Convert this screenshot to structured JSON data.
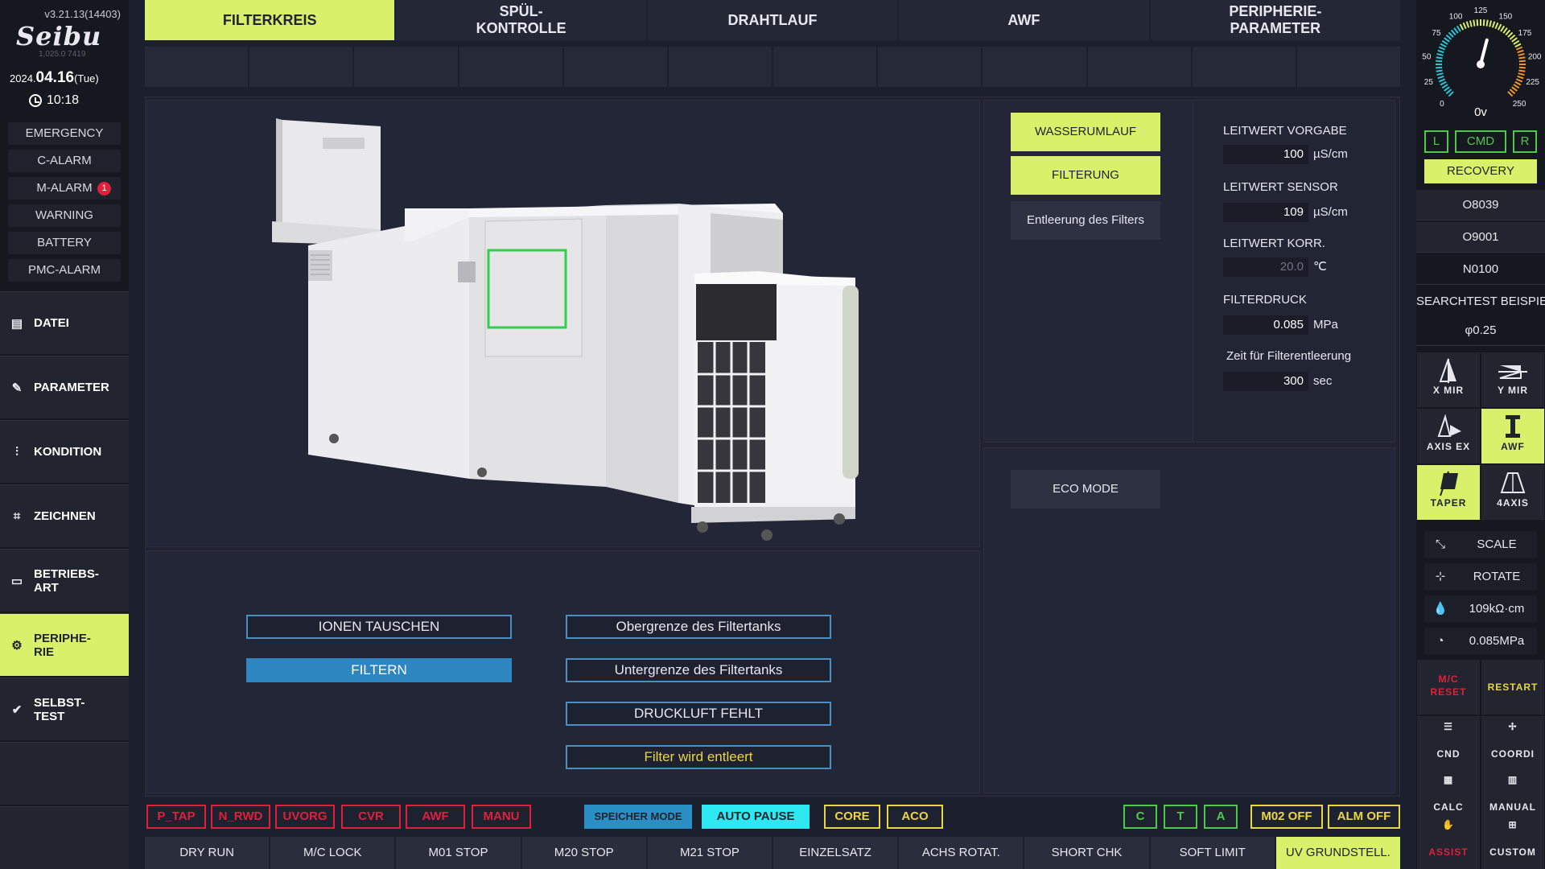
{
  "header": {
    "version": "v3.21.13(14403)",
    "brand": "Seibu",
    "brand_sub": "1,025.0    7419",
    "date_year": "2024.",
    "date_day": "04.16",
    "date_weekday": "(Tue)",
    "time": "10:18"
  },
  "alarms": [
    {
      "label": "EMERGENCY"
    },
    {
      "label": "C-ALARM"
    },
    {
      "label": "M-ALARM",
      "badge": "1"
    },
    {
      "label": "WARNING"
    },
    {
      "label": "BATTERY"
    },
    {
      "label": "PMC-ALARM"
    }
  ],
  "nav": [
    {
      "label": "DATEI",
      "icon": "file-icon"
    },
    {
      "label": "PARAMETER",
      "icon": "wrench-icon"
    },
    {
      "label": "KONDITION",
      "icon": "sliders-icon"
    },
    {
      "label": "ZEICHNEN",
      "icon": "draw-icon"
    },
    {
      "label_line1": "BETRIEBS-",
      "label_line2": "ART",
      "icon": "window-icon"
    },
    {
      "label_line1": "PERIPHE-",
      "label_line2": "RIE",
      "icon": "gear-icon",
      "active": true
    },
    {
      "label_line1": "SELBST-",
      "label_line2": "TEST",
      "icon": "check-icon"
    }
  ],
  "tabs": [
    {
      "label": "FILTERKREIS",
      "active": true
    },
    {
      "label_line1": "SPÜL-",
      "label_line2": "KONTROLLE"
    },
    {
      "label": "DRAHTLAUF"
    },
    {
      "label": "AWF"
    },
    {
      "label_line1": "PERIPHERIE-",
      "label_line2": "PARAMETER"
    }
  ],
  "controls": {
    "wasserumlauf": "WASSERUMLAUF",
    "filterung": "FILTERUNG",
    "entleerung": "Entleerung des Filters",
    "eco_mode": "ECO MODE"
  },
  "params": [
    {
      "label": "LEITWERT VORGABE",
      "value": "100",
      "unit": "µS/cm"
    },
    {
      "label": "LEITWERT SENSOR",
      "value": "109",
      "unit": "µS/cm"
    },
    {
      "label": "LEITWERT KORR.",
      "value": "20.0",
      "unit": "℃"
    },
    {
      "label": "FILTERDRUCK",
      "value": "0.085",
      "unit": "MPa"
    },
    {
      "label": "Zeit für Filterentleerung",
      "value": "300",
      "unit": "sec"
    }
  ],
  "status_buttons": {
    "ionen": "IONEN TAUSCHEN",
    "filtern": "FILTERN",
    "obergrenze": "Obergrenze des Filtertanks",
    "untergrenze": "Untergrenze des Filtertanks",
    "druckluft": "DRUCKLUFT FEHLT",
    "entleert": "Filter wird entleert"
  },
  "status_bar": {
    "p_tap": "P_TAP",
    "n_rwd": "N_RWD",
    "uvorg": "UVORG",
    "cvr": "CVR",
    "awf": "AWF",
    "manu": "MANU",
    "speicher": "SPEICHER MODE",
    "auto_pause": "AUTO PAUSE",
    "core": "CORE",
    "aco": "ACO",
    "c": "C",
    "t": "T",
    "a": "A",
    "m02": "M02 OFF",
    "alm": "ALM OFF"
  },
  "function_keys": [
    {
      "label": "DRY RUN"
    },
    {
      "label": "M/C LOCK"
    },
    {
      "label": "M01 STOP"
    },
    {
      "label": "M20 STOP"
    },
    {
      "label": "M21 STOP"
    },
    {
      "label": "EINZELSATZ"
    },
    {
      "label": "ACHS ROTAT."
    },
    {
      "label": "SHORT CHK"
    },
    {
      "label": "SOFT LIMIT"
    },
    {
      "label": "UV GRUNDSTELL.",
      "active": true
    }
  ],
  "gauge": {
    "ticks": [
      "0",
      "25",
      "50",
      "75",
      "100",
      "125",
      "150",
      "175",
      "200",
      "225",
      "250"
    ],
    "readout": "0v",
    "value": 125
  },
  "right_panel": {
    "l": "L",
    "cmd": "CMD",
    "r": "R",
    "recovery": "RECOVERY",
    "prog1": "O8039",
    "prog2": "O9001",
    "seq": "N0100",
    "search": "SEARCHTEST BEISPIEL",
    "wire": "φ0.25",
    "tiles": {
      "x_mir": "X MIR",
      "y_mir": "Y MIR",
      "axis_ex": "AXIS EX",
      "awf": "AWF",
      "taper": "TAPER",
      "axis4": "4AXIS"
    },
    "scale": "SCALE",
    "rotate": "ROTATE",
    "resistivity": "109kΩ·cm",
    "pressure": "0.085MPa",
    "mc_reset_line1": "M/C",
    "mc_reset_line2": "RESET",
    "restart": "RESTART",
    "cnd": "CND",
    "coordi": "COORDI",
    "calc": "CALC",
    "manual": "MANUAL",
    "assist": "ASSIST",
    "custom": "CUSTOM"
  },
  "colors": {
    "accent": "#d8f06a",
    "alert": "#e0203a",
    "info": "#2a8fc5",
    "ok": "#4fc84a"
  }
}
